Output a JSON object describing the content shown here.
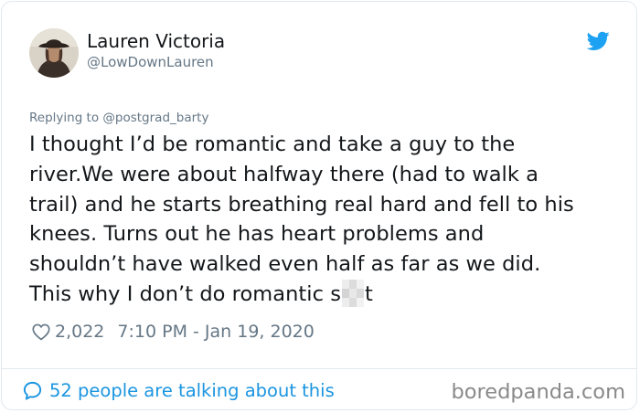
{
  "tweet": {
    "author": {
      "display_name": "Lauren Victoria",
      "handle": "@LowDownLauren",
      "avatar_icon": "avatar-photo"
    },
    "brand_icon": "twitter-bird-icon",
    "reply_to": "Replying to @postgrad_barty",
    "text_lines": [
      "I thought I’d be romantic and take a guy to the",
      "river.We were about halfway there (had to walk a",
      "trail) and he starts breathing real hard and fell to his",
      "knees. Turns out he has heart problems and",
      "shouldn’t have walked even half as far as we did.",
      "This why I don’t do romantic s",
      "t"
    ],
    "likes": "2,022",
    "timestamp": "7:10 PM - Jan 19, 2020",
    "talking": "52 people are talking about this"
  },
  "watermark": "boredpanda.com",
  "colors": {
    "text": "#14171a",
    "secondary": "#657786",
    "accent": "#1b95e0",
    "twitter_blue": "#1da1f2",
    "border": "#e1e8ed"
  }
}
